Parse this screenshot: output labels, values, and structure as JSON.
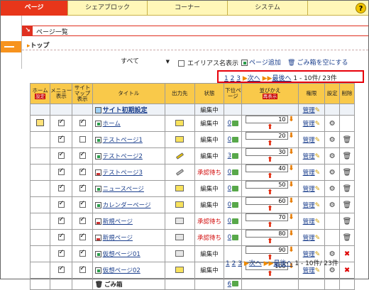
{
  "tabs": [
    {
      "label": "ページ",
      "active": true
    },
    {
      "label": "シェアブロック",
      "active": false
    },
    {
      "label": "コーナー",
      "active": false
    },
    {
      "label": "システム",
      "active": false
    }
  ],
  "help_label": "?",
  "section_title": "ページ一覧",
  "crumb": "トップ",
  "filter": {
    "select_value": "すべて",
    "alias_label": "エイリアス名表示",
    "page_add": "ページ追加",
    "trash_empty": "ごみ箱を空にする"
  },
  "pager": {
    "pages": [
      "1",
      "2",
      "3"
    ],
    "next": "次へ",
    "last": "最後へ",
    "range": "1 - 10件/ 23件"
  },
  "table": {
    "headers": {
      "home": "ホーム",
      "home_badge": "設定",
      "menu": "メニュー表示",
      "sitemap": "サイトマップ表示",
      "title": "タイトル",
      "output": "出力先",
      "status": "状態",
      "lower": "下位ページ",
      "order": "並びかえ",
      "order_badge": "再表示",
      "perm": "権限",
      "setting": "設定",
      "delete": "削除"
    },
    "site_row": {
      "title": "サイト初期設定",
      "status": "編集中",
      "perm": "管理"
    },
    "rows": [
      {
        "home": true,
        "menu": true,
        "sitemap": true,
        "title": "ホーム",
        "icon": "doc",
        "output": "on",
        "status": "編集中",
        "lower": "0",
        "order": "10",
        "perm": "管理",
        "gear": true,
        "trash": false,
        "deleted": false
      },
      {
        "home": false,
        "menu": true,
        "sitemap": false,
        "title": "テストページ1",
        "icon": "doc",
        "output": "on",
        "status": "編集中",
        "lower": "0",
        "order": "20",
        "perm": "管理",
        "gear": true,
        "trash": true,
        "deleted": false
      },
      {
        "home": false,
        "menu": true,
        "sitemap": true,
        "title": "テストページ2",
        "icon": "doc",
        "output": "pen",
        "status": "編集中",
        "lower": "3",
        "order": "30",
        "perm": "管理",
        "gear": true,
        "trash": true,
        "deleted": false
      },
      {
        "home": false,
        "menu": true,
        "sitemap": true,
        "title": "テストページ3",
        "icon": "img",
        "output": "pengray",
        "status": "承認待ち",
        "lower": "0",
        "order": "40",
        "perm": "管理",
        "gear": true,
        "trash": true,
        "deleted": false
      },
      {
        "home": false,
        "menu": true,
        "sitemap": true,
        "title": "ニュースページ",
        "icon": "doc",
        "output": "on",
        "status": "編集中",
        "lower": "0",
        "order": "50",
        "perm": "管理",
        "gear": true,
        "trash": true,
        "deleted": false
      },
      {
        "home": false,
        "menu": true,
        "sitemap": true,
        "title": "カレンダーページ",
        "icon": "doc",
        "output": "on",
        "status": "編集中",
        "lower": "0",
        "order": "60",
        "perm": "管理",
        "gear": true,
        "trash": true,
        "deleted": false
      },
      {
        "home": false,
        "menu": true,
        "sitemap": true,
        "title": "新規ページ",
        "icon": "img",
        "output": "off",
        "status": "承認待ち",
        "lower": "0",
        "order": "70",
        "perm": "管理",
        "gear": false,
        "trash": true,
        "deleted": false
      },
      {
        "home": false,
        "menu": true,
        "sitemap": true,
        "title": "新規ページ",
        "icon": "img",
        "output": "off",
        "status": "承認待ち",
        "lower": "0",
        "order": "80",
        "perm": "管理",
        "gear": false,
        "trash": true,
        "deleted": false
      },
      {
        "home": false,
        "menu": true,
        "sitemap": true,
        "title": "仮想ページ01",
        "icon": "doc",
        "output": "off",
        "status": "編集中",
        "lower": "",
        "order": "90",
        "perm": "管理",
        "gear": true,
        "trash": true,
        "deleted": true
      },
      {
        "home": false,
        "menu": true,
        "sitemap": true,
        "title": "仮想ページ02",
        "icon": "doc",
        "output": "on",
        "status": "編集中",
        "lower": "",
        "order": "100",
        "perm": "管理",
        "gear": true,
        "trash": true,
        "deleted": true
      }
    ],
    "trash_row": {
      "title": "ごみ箱",
      "lower": "6"
    }
  },
  "colors": {
    "tab_active": "#e8361a",
    "header": "#f9c94a",
    "link": "#1a3e8c",
    "wait": "#d00000",
    "highlight": "#e8000a"
  }
}
